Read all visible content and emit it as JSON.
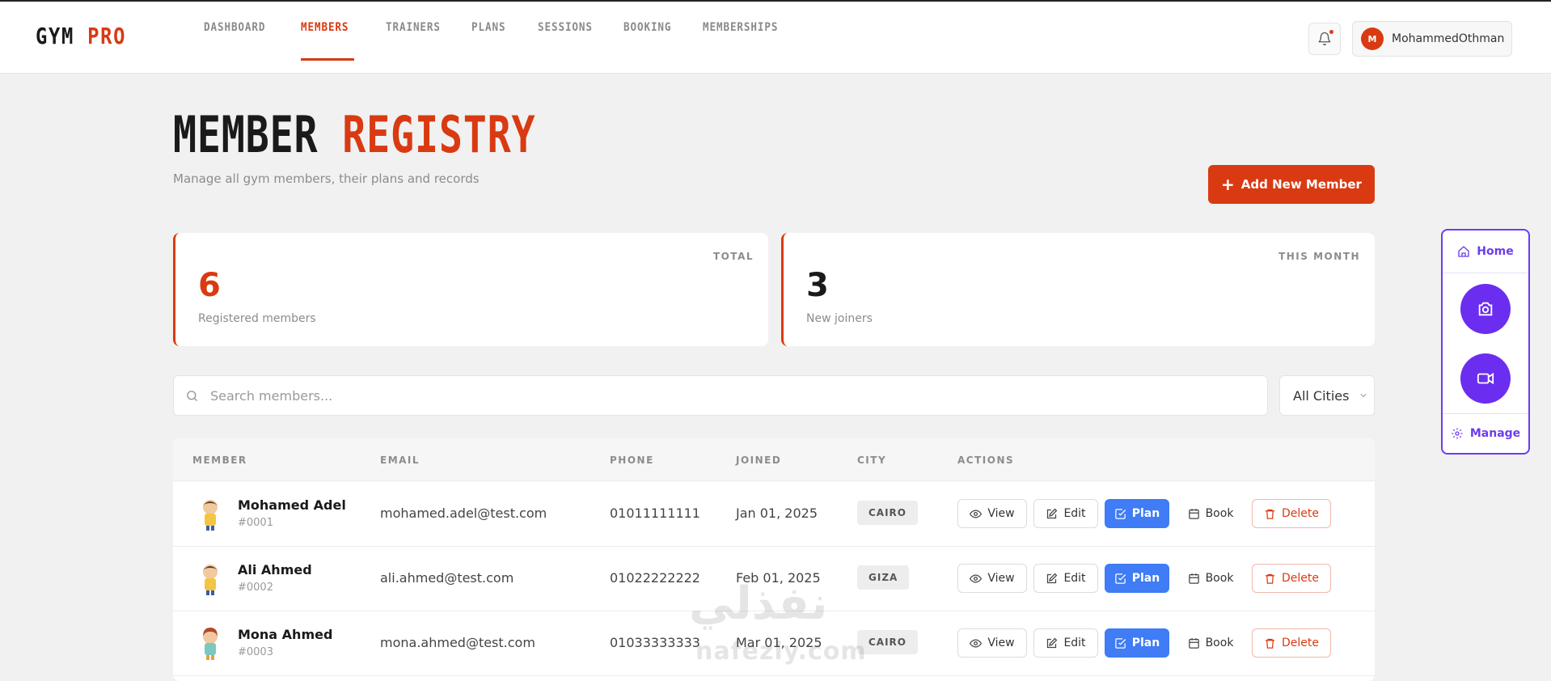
{
  "app": {
    "logo_main": "GYM",
    "logo_accent": "PRO"
  },
  "nav": {
    "tabs": [
      {
        "label": "DASHBOARD"
      },
      {
        "label": "MEMBERS"
      },
      {
        "label": "TRAINERS"
      },
      {
        "label": "PLANS"
      },
      {
        "label": "SESSIONS"
      },
      {
        "label": "BOOKING"
      },
      {
        "label": "MEMBERSHIPS"
      }
    ],
    "active_tab": "MEMBERS"
  },
  "user": {
    "initial": "M",
    "name": "MohammedOthman"
  },
  "page": {
    "title_main": "MEMBER",
    "title_accent": "REGISTRY",
    "subtitle": "Manage all gym members, their plans and records",
    "add_button": "Add New Member"
  },
  "stats": [
    {
      "label": "TOTAL",
      "value": "6",
      "caption": "Registered members",
      "value_color": "#d93a12"
    },
    {
      "label": "THIS MONTH",
      "value": "3",
      "caption": "New joiners",
      "value_color": "#1a1a1a"
    }
  ],
  "filters": {
    "search_placeholder": "Search members...",
    "city_selected": "All Cities"
  },
  "table": {
    "columns": [
      "MEMBER",
      "EMAIL",
      "PHONE",
      "JOINED",
      "CITY",
      "ACTIONS"
    ],
    "actions": {
      "view": "View",
      "edit": "Edit",
      "plan": "Plan",
      "book": "Book",
      "delete": "Delete"
    },
    "rows": [
      {
        "name": "Mohamed Adel",
        "id": "#0001",
        "email": "mohamed.adel@test.com",
        "phone": "01011111111",
        "joined": "Jan 01, 2025",
        "city": "CAIRO"
      },
      {
        "name": "Ali Ahmed",
        "id": "#0002",
        "email": "ali.ahmed@test.com",
        "phone": "01022222222",
        "joined": "Feb 01, 2025",
        "city": "GIZA"
      },
      {
        "name": "Mona Ahmed",
        "id": "#0003",
        "email": "mona.ahmed@test.com",
        "phone": "01033333333",
        "joined": "Mar 01, 2025",
        "city": "CAIRO"
      }
    ]
  },
  "widget": {
    "home": "Home",
    "manage": "Manage"
  },
  "watermark": {
    "arabic": "نفذلي",
    "latin": "nafezly.com"
  },
  "colors": {
    "accent": "#d93a12",
    "plan_blue": "#3f7cf5",
    "widget_purple": "#6b2ef0"
  }
}
